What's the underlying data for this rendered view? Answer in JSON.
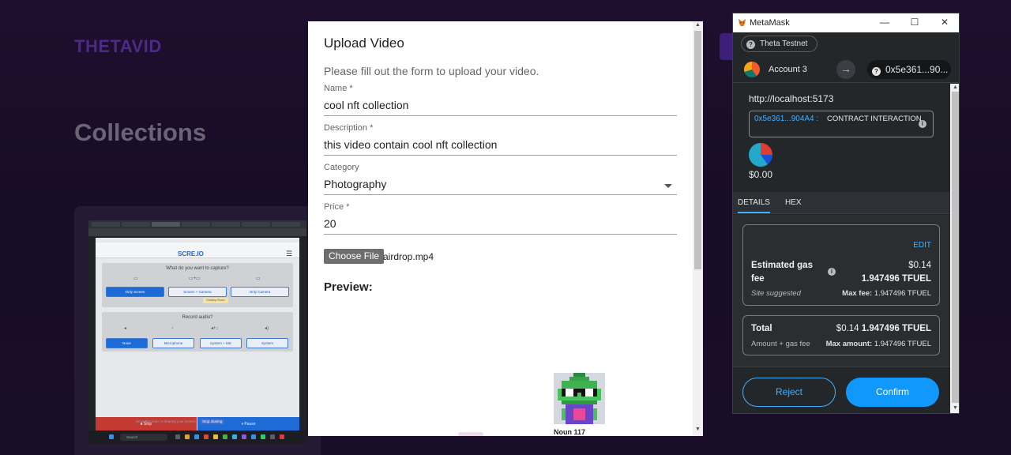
{
  "background": {
    "brand": "THETAVID",
    "heading": "Collections",
    "card_caption": "",
    "thumbnail": {
      "logo": "SCRE.IO",
      "menu": "☰",
      "capture_question": "What do you want to capture?",
      "capture_options": [
        "Only Screen",
        "Screen + Camera",
        "Only Camera"
      ],
      "camera_tooltip": "Desktop Room",
      "audio_question": "Record audio?",
      "audio_options": [
        "None",
        "Microphone",
        "System + Mic",
        "System"
      ],
      "stop_label": "⏹ Stop",
      "pause_label": "⏸ Pause",
      "share_text": "ScreeRecorder is sharing your screen.",
      "stop_sharing": "Stop sharing",
      "taskbar_search": "Search"
    }
  },
  "modal": {
    "title": "Upload Video",
    "subtitle": "Please fill out the form to upload your video.",
    "fields": {
      "name": {
        "label": "Name *",
        "value": "cool nft collection"
      },
      "description": {
        "label": "Description *",
        "value": "this video contain cool nft collection"
      },
      "category": {
        "label": "Category",
        "value": "Photography"
      },
      "price": {
        "label": "Price *",
        "value": "20"
      }
    },
    "file_button": "Choose File",
    "file_name": "airdrop.mp4",
    "preview_heading": "Preview:",
    "nft_label": "Noun 117"
  },
  "metamask": {
    "window_title": "MetaMask",
    "window_controls": [
      "—",
      "☐",
      "✕"
    ],
    "network": "Theta Testnet",
    "account_name": "Account 3",
    "account_address": "0x5e361...90...",
    "origin": "http://localhost:5173",
    "contract_address": "0x5e361...904A4 :",
    "interaction_type": "CONTRACT INTERACTION",
    "amount_usd": "$0.00",
    "tabs": [
      "DETAILS",
      "HEX"
    ],
    "edit_label": "EDIT",
    "gas": {
      "label": "Estimated gas fee",
      "usd": "$0.14",
      "amount": "1.947496 TFUEL",
      "note": "Site suggested",
      "max_fee_label": "Max fee:",
      "max_fee_value": "1.947496 TFUEL"
    },
    "total": {
      "label": "Total",
      "usd": "$0.14",
      "amount": "1.947496 TFUEL",
      "note": "Amount + gas fee",
      "max_amount_label": "Max amount:",
      "max_amount_value": "1.947496 TFUEL"
    },
    "reject_label": "Reject",
    "confirm_label": "Confirm"
  },
  "colors": {
    "accent_blue": "#43aefc",
    "confirm_blue": "#1098fc",
    "mm_bg": "#24272a",
    "brand_purple": "#4b2a8a"
  }
}
